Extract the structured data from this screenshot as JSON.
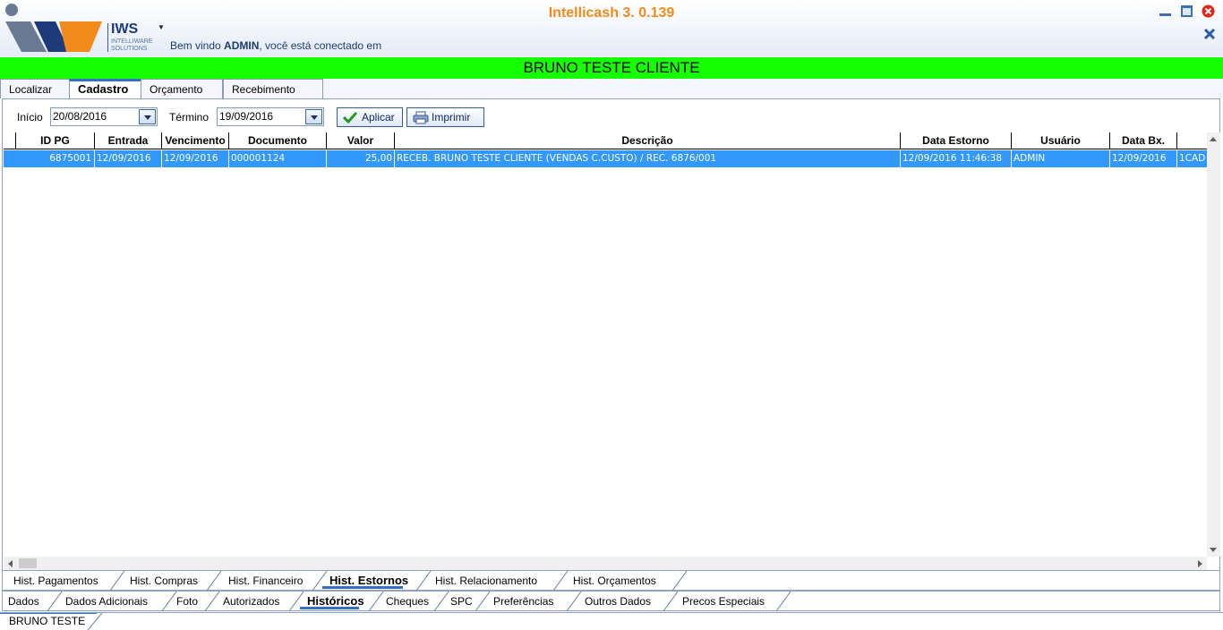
{
  "header": {
    "app_title": "Intellicash 3. 0.139",
    "logo_text": "IWS",
    "logo_sub_1": "INTELLIWARE",
    "logo_sub_2": "SOLUTIONS",
    "welcome_prefix": "Bem vindo ",
    "welcome_user": "ADMIN",
    "welcome_suffix": ", você está conectado em"
  },
  "client_name": "BRUNO TESTE CLIENTE",
  "top_tabs": [
    "Localizar",
    "Cadastro",
    "Orçamento",
    "Recebimento"
  ],
  "filter": {
    "start_label": "Início",
    "start_value": "20/08/2016",
    "end_label": "Término",
    "end_value": "19/09/2016",
    "apply_label": "Aplicar",
    "print_label": "Imprimir"
  },
  "grid": {
    "columns": [
      "ID PG",
      "Entrada",
      "Vencimento",
      "Documento",
      "Valor",
      "Descrição",
      "Data Estorno",
      "Usuário",
      "Data Bx."
    ],
    "rows": [
      [
        "6875001",
        "12/09/2016",
        "12/09/2016",
        "000001124",
        "25,00",
        "RECEB. BRUNO TESTE CLIENTE (VENDAS  C.CUSTO) / REC. 6876/001",
        "12/09/2016 11:46:38",
        "ADMIN",
        "12/09/2016",
        "1CAD"
      ]
    ]
  },
  "hist_tabs": [
    "Hist. Pagamentos",
    "Hist. Compras",
    "Hist. Financeiro",
    "Hist. Estornos",
    "Hist. Relacionamento",
    "Hist. Orçamentos"
  ],
  "data_tabs": [
    "Dados",
    "Dados Adicionais",
    "Foto",
    "Autorizados",
    "Históricos",
    "Cheques",
    "SPC",
    "Preferências",
    "Outros Dados",
    "Precos Especiais"
  ],
  "status_tab": "BRUNO TESTE",
  "colors": {
    "client_bar": "#15ff00",
    "title": "#f08a1a",
    "selection": "#3298fb"
  }
}
